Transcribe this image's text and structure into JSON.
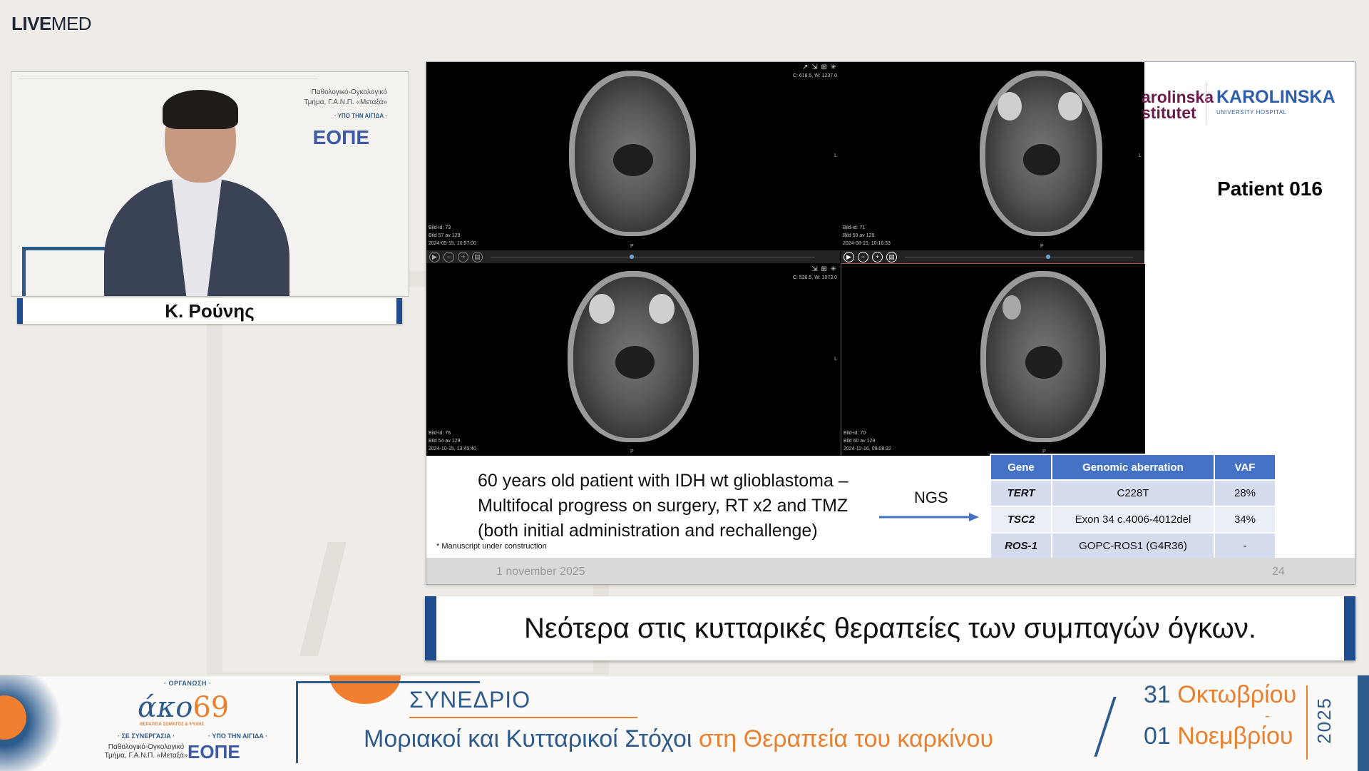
{
  "brand": {
    "logo_bold": "LIVE",
    "logo_light": "MED"
  },
  "speaker": {
    "name": "Κ. Ρούνης",
    "video_text": {
      "org_line1": "Παθολογικό-Ογκολογικό",
      "org_line2": "Τμήμα, Γ.Α.Ν.Π. «Μεταξά»",
      "auspices": "· ΥΠΟ ΤΗΝ ΑΙΓΙΔΑ ·",
      "eope": "ΕΟΠΕ"
    }
  },
  "slide": {
    "logos": {
      "left": "arolinska\nstitutet",
      "right": "KAROLINSKA",
      "right_sub": "UNIVERSITY HOSPITAL"
    },
    "patient_title": "Patient 016",
    "mri_panes": [
      {
        "meta": [
          "Bild-id: 73",
          "Bild 57 av 129",
          "2024-05-15, 10:57:00"
        ],
        "cw": "C: 618.5, W: 1237.0",
        "tools": "↗ ⇲ ⊞ ✳",
        "p": "P",
        "l": "L"
      },
      {
        "meta": [
          "Bild-id: 71",
          "Bild 59 av 129",
          "2024-08-15, 10:16:33"
        ],
        "cw": "",
        "tools": "",
        "p": "P",
        "l": "L"
      },
      {
        "meta": [
          "Bild-id: 76",
          "Bild 54 av 129",
          "2024-10-15, 13:43:40"
        ],
        "cw": "C: 536.5, W: 1073.0",
        "tools": "⇲ ⊞ ✳",
        "p": "P",
        "l": "L"
      },
      {
        "meta": [
          "Bild-id: 70",
          "Bild 60 av 129",
          "2024-12-16, 09:08:32"
        ],
        "cw": "",
        "tools": "",
        "p": "P",
        "l": ""
      }
    ],
    "description": "60 years old patient with IDH wt glioblastoma –\nMultifocal progress on surgery, RT x2 and TMZ\n(both initial administration and rechallenge)",
    "manuscript_note": "* Manuscript under construction",
    "ngs_label": "NGS",
    "table": {
      "headers": [
        "Gene",
        "Genomic aberration",
        "VAF"
      ],
      "rows": [
        [
          "TERT",
          "C228T",
          "28%"
        ],
        [
          "TSC2",
          "Exon 34 c.4006-4012del",
          "34%"
        ],
        [
          "ROS-1",
          "GOPC-ROS1 (G4R36)",
          "-"
        ]
      ]
    },
    "footer_date": "1 november 2025",
    "footer_page": "24"
  },
  "subtitle": "Νεότερα στις κυτταρικές θεραπείες των συμπαγών όγκων.",
  "banner": {
    "organizer_label": "· ΟΡΓΑΝΩΣΗ ·",
    "ako_logo_a": "άκο",
    "ako_logo_b": "69",
    "ako_sub": "ΘΕΡΑΠΕΙΑ ΣΩΜΑΤΟΣ & ΨΥΧΗΣ",
    "coop_label": "· ΣΕ ΣΥΝΕΡΓΑΣΙΑ ·",
    "auspices_label": "· ΥΠΟ ΤΗΝ ΑΙΓΙΔΑ ·",
    "coop_line1": "Παθολογικό-Ογκολογικό",
    "coop_line2": "Τμήμα, Γ.Α.Ν.Π. «Μεταξά»",
    "eope": "ΕΟΠΕ",
    "congress_label": "ΣΥΝΕΔΡΙΟ",
    "title_part1": "Μοριακοί και Κυτταρικοί Στόχοι ",
    "title_part2": "στη Θεραπεία του καρκίνου",
    "date1_num": "31",
    "date1_month": "Οκτωβρίου",
    "date_dash": "-",
    "date2_num": "01",
    "date2_month": "Νοεμβρίου",
    "year": "2025"
  },
  "colors": {
    "accent_blue": "#1e4c8c",
    "brand_blue": "#2d5b8c",
    "brand_orange": "#e8802f",
    "table_header": "#4472c4"
  }
}
